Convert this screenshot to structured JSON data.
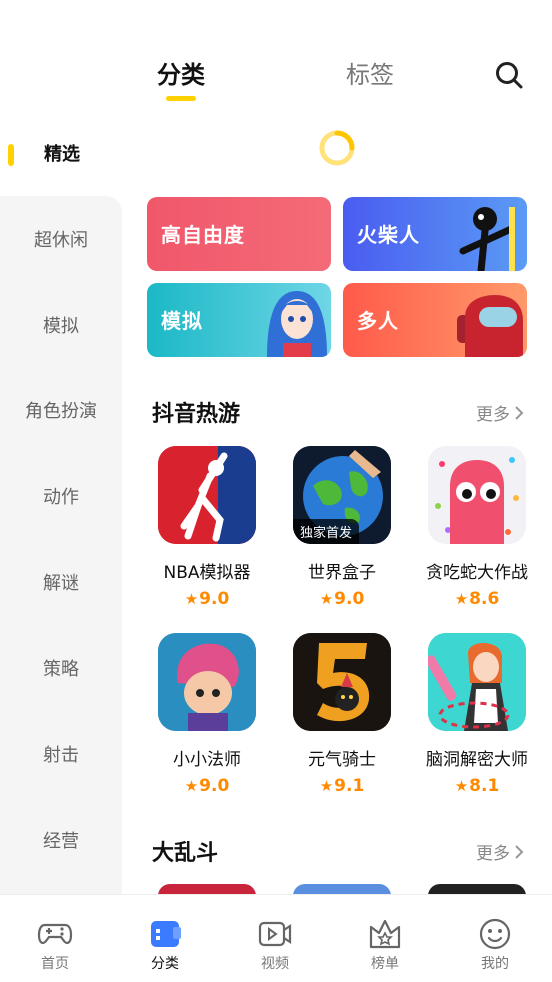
{
  "header": {
    "tabs": [
      {
        "label": "分类",
        "active": true
      },
      {
        "label": "标签",
        "active": false
      }
    ]
  },
  "sidebar": {
    "items": [
      {
        "label": "精选",
        "active": true
      },
      {
        "label": "超休闲"
      },
      {
        "label": "模拟"
      },
      {
        "label": "角色扮演"
      },
      {
        "label": "动作"
      },
      {
        "label": "解谜"
      },
      {
        "label": "策略"
      },
      {
        "label": "射击"
      },
      {
        "label": "经营"
      }
    ]
  },
  "categories": [
    {
      "label": "高自由度",
      "color": "#F0576A"
    },
    {
      "label": "火柴人",
      "color": "#4A6CF0"
    },
    {
      "label": "模拟",
      "color": "#1FC0C8"
    },
    {
      "label": "多人",
      "color": "#FF6A4A"
    }
  ],
  "sections": [
    {
      "title": "抖音热游",
      "more": "更多",
      "games": [
        {
          "name": "NBA模拟器",
          "rating": "9.0",
          "icon": "basketball-player-icon"
        },
        {
          "name": "世界盒子",
          "rating": "9.0",
          "icon": "world-globe-icon",
          "badge": "独家首发"
        },
        {
          "name": "贪吃蛇大作战",
          "rating": "8.6",
          "icon": "snake-eyes-icon"
        },
        {
          "name": "小小法师",
          "rating": "9.0",
          "icon": "wizard-character-icon"
        },
        {
          "name": "元气骑士",
          "rating": "9.1",
          "icon": "soul-knight-icon"
        },
        {
          "name": "脑洞解密大师",
          "rating": "8.1",
          "icon": "maid-puzzle-icon"
        }
      ]
    },
    {
      "title": "大乱斗",
      "more": "更多"
    }
  ],
  "bottom_nav": [
    {
      "label": "首页",
      "icon": "gamepad-icon"
    },
    {
      "label": "分类",
      "icon": "category-icon",
      "active": true
    },
    {
      "label": "视频",
      "icon": "video-icon"
    },
    {
      "label": "榜单",
      "icon": "ranking-icon"
    },
    {
      "label": "我的",
      "icon": "profile-smile-icon"
    }
  ],
  "colors": {
    "accent": "#FFD100",
    "rating": "#FF8A00",
    "nav_active": "#3A7BFF"
  }
}
